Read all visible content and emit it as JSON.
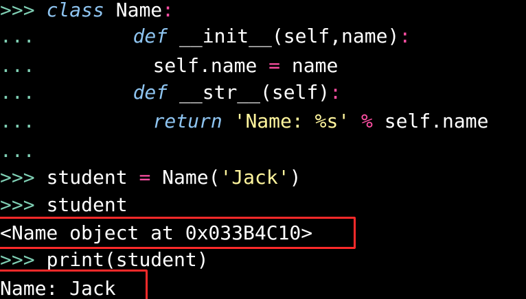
{
  "terminal": {
    "lines": {
      "l1": {
        "prompt": ">>>",
        "kw": "class",
        "name": "Name",
        "colon": ":"
      },
      "l2": {
        "cont": "...",
        "kw": "def",
        "func": "__init__(self,name)",
        "colon": ":"
      },
      "l3": {
        "cont": "...",
        "lhs": "self.name",
        "op": "=",
        "rhs": "name"
      },
      "l4": {
        "cont": "...",
        "kw": "def",
        "func": "__str__(self)",
        "colon": ":"
      },
      "l5": {
        "cont": "...",
        "kw": "return",
        "str": "'Name: %s'",
        "op": "%",
        "rhs": "self.name"
      },
      "l6": {
        "cont": "..."
      },
      "l7": {
        "prompt": ">>>",
        "lhs": "student",
        "op": "=",
        "call_pre": "Name(",
        "str": "'Jack'",
        "call_post": ")"
      },
      "l8": {
        "prompt": ">>>",
        "text": "student"
      },
      "l9": {
        "output": "<Name object at 0x033B4C10>"
      },
      "l10": {
        "prompt": ">>>",
        "text": "print(student)"
      },
      "l11": {
        "output": "Name: Jack"
      }
    }
  },
  "colors": {
    "background": "#000000",
    "prompt": "#7fcfb4",
    "keyword": "#8ec4f0",
    "operator": "#ff4fa3",
    "string": "#fff59d",
    "highlight_box": "#ff2a2a"
  }
}
